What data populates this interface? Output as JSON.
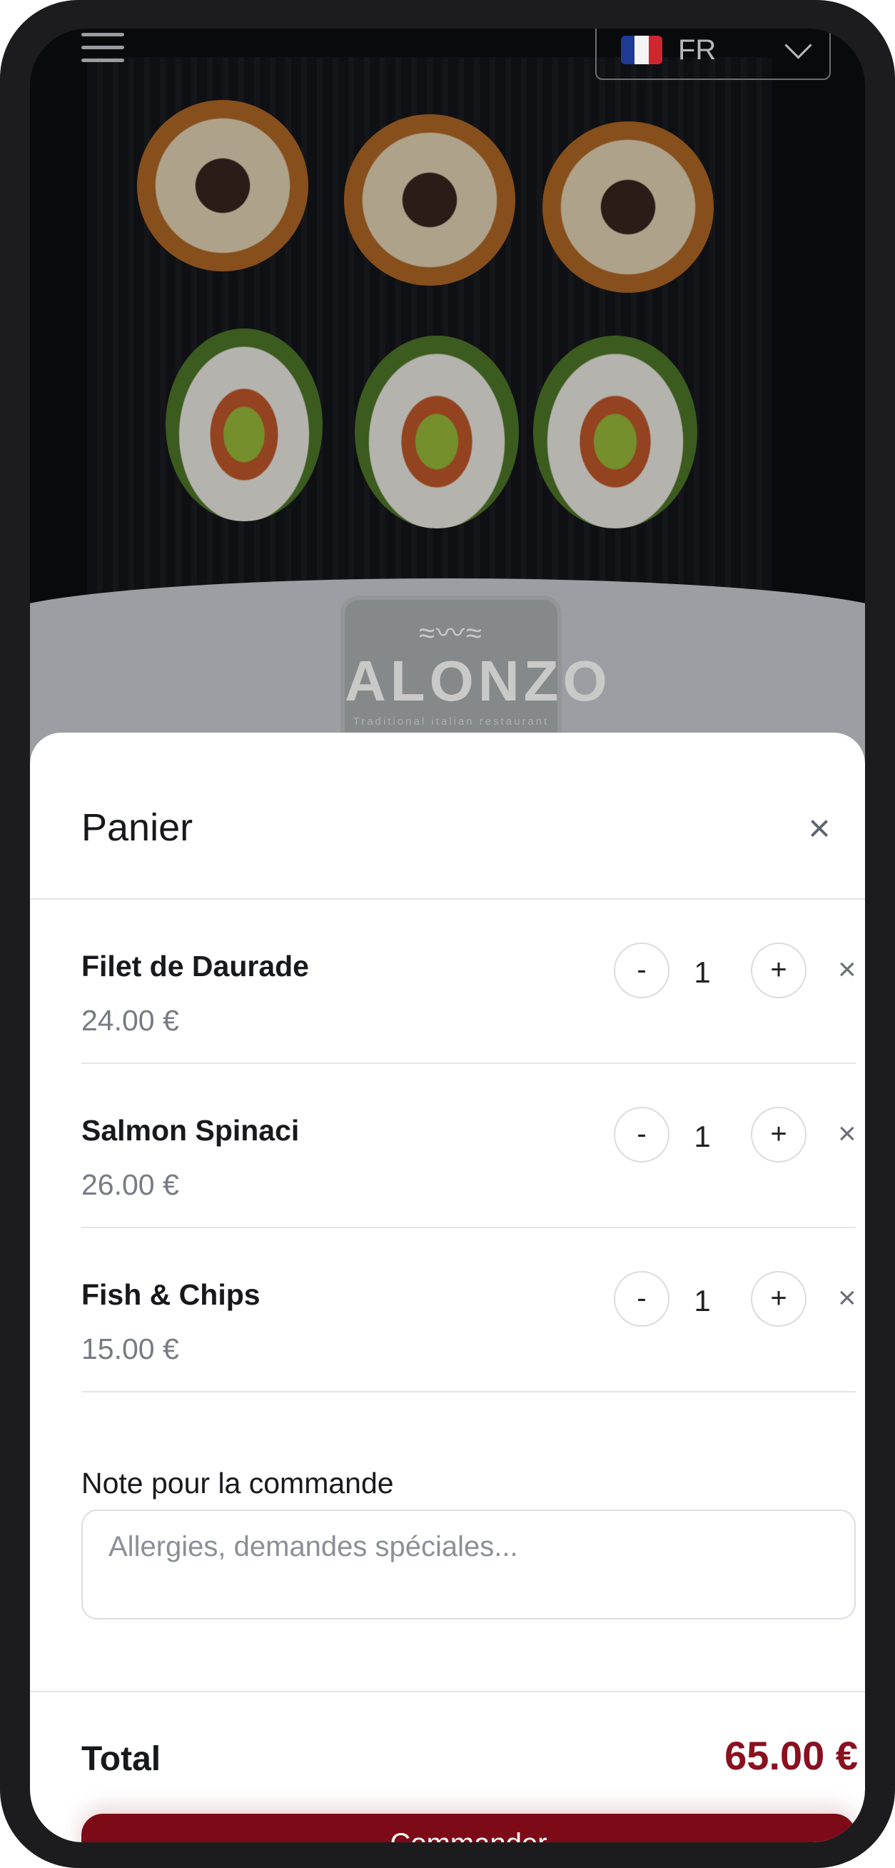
{
  "header": {
    "language": {
      "code": "FR",
      "flag_colors": [
        "#1f3a93",
        "#f4f4f4",
        "#d0262f"
      ]
    }
  },
  "brand": {
    "name": "ALONZO",
    "tagline": "Traditional italian restaurant"
  },
  "cart": {
    "title": "Panier",
    "items": [
      {
        "name": "Filet de Daurade",
        "price": "24.00 €",
        "quantity": "1"
      },
      {
        "name": "Salmon Spinaci",
        "price": "26.00 €",
        "quantity": "1"
      },
      {
        "name": "Fish & Chips",
        "price": "15.00 €",
        "quantity": "1"
      }
    ],
    "minus_label": "-",
    "plus_label": "+",
    "note": {
      "label": "Note pour la commande",
      "placeholder": "Allergies, demandes spéciales..."
    },
    "total_label": "Total",
    "total_value": "65.00 €",
    "order_button": "Commander"
  },
  "colors": {
    "accent": "#7d0b17",
    "total": "#8a1020"
  }
}
